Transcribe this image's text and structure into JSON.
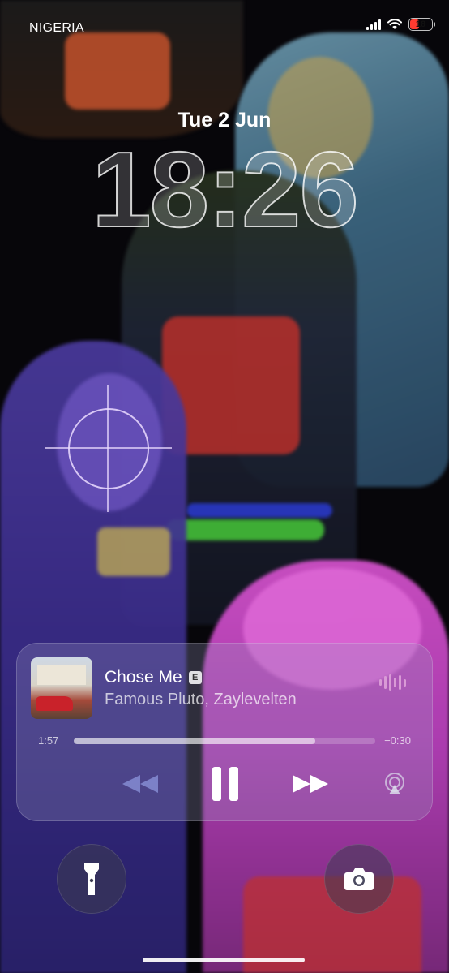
{
  "status_bar": {
    "carrier": "NIGERIA",
    "battery": "18"
  },
  "lock_screen": {
    "date": "Tue 2 Jun",
    "time": "18:26"
  },
  "now_playing": {
    "song": "Chose Me",
    "explicit": "E",
    "artist": "Famous Pluto, Zaylevelten",
    "elapsed": "1:57",
    "remaining": "−0:30",
    "progress_fraction": 0.8
  },
  "icons": {
    "rewind": "rewind-icon",
    "pause": "pause-icon",
    "forward": "fast-forward-icon",
    "airplay": "airplay-icon",
    "flashlight": "flashlight-icon",
    "camera": "camera-icon",
    "waveform": "audio-waveform-icon"
  },
  "colors": {
    "battery_low": "#ff3b30",
    "waveform": "#d99ad6"
  }
}
